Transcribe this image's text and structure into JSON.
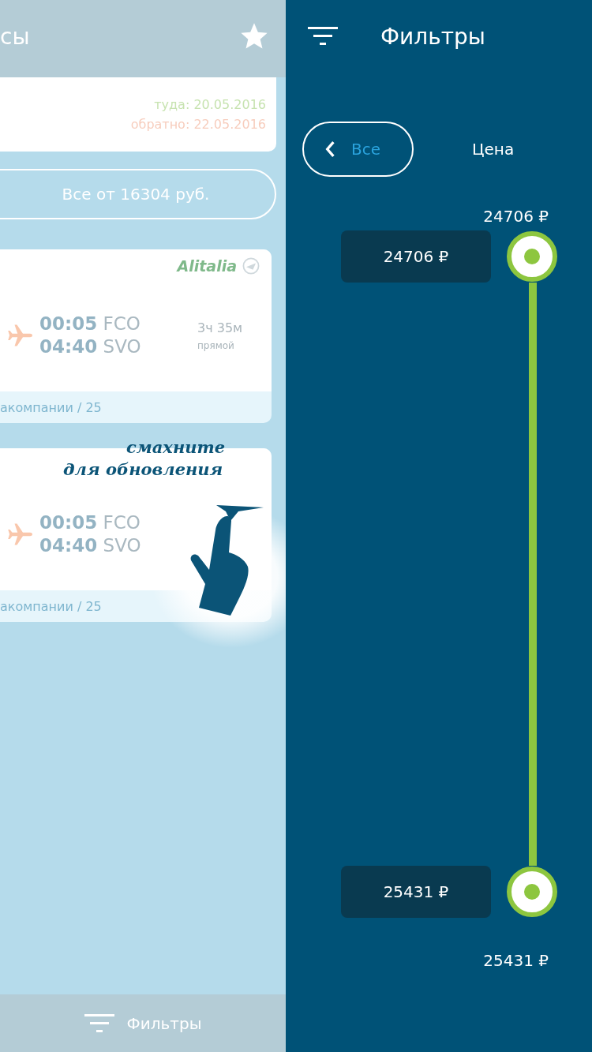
{
  "results_panel": {
    "title": "сы",
    "dates": {
      "outbound": "туда: 20.05.2016",
      "return": "обратно: 22.05.2016"
    },
    "all_button": "Все от 16304 руб.",
    "flights": [
      {
        "airline_logo": "Alitalia",
        "depart_time": "00:05",
        "depart_airport": "FCO",
        "arrive_time": "04:40",
        "arrive_airport": "SVO",
        "duration": "3ч 35м",
        "stops": "прямой",
        "footer": "акомпании / 25"
      },
      {
        "depart_time": "00:05",
        "depart_airport": "FCO",
        "arrive_time": "04:40",
        "arrive_airport": "SVO",
        "footer": "акомпании / 25"
      }
    ],
    "swipe_hint": [
      "смахните",
      "для обновления"
    ],
    "bottom_bar": {
      "label": "Фильтры"
    }
  },
  "filters_panel": {
    "title": "Фильтры",
    "back_button": "Все",
    "section": "Цена",
    "max_label": "24706 ₽",
    "min_label": "25431 ₽",
    "thumbs": [
      {
        "tooltip": "24706 ₽"
      },
      {
        "tooltip": "25431 ₽"
      }
    ]
  }
}
